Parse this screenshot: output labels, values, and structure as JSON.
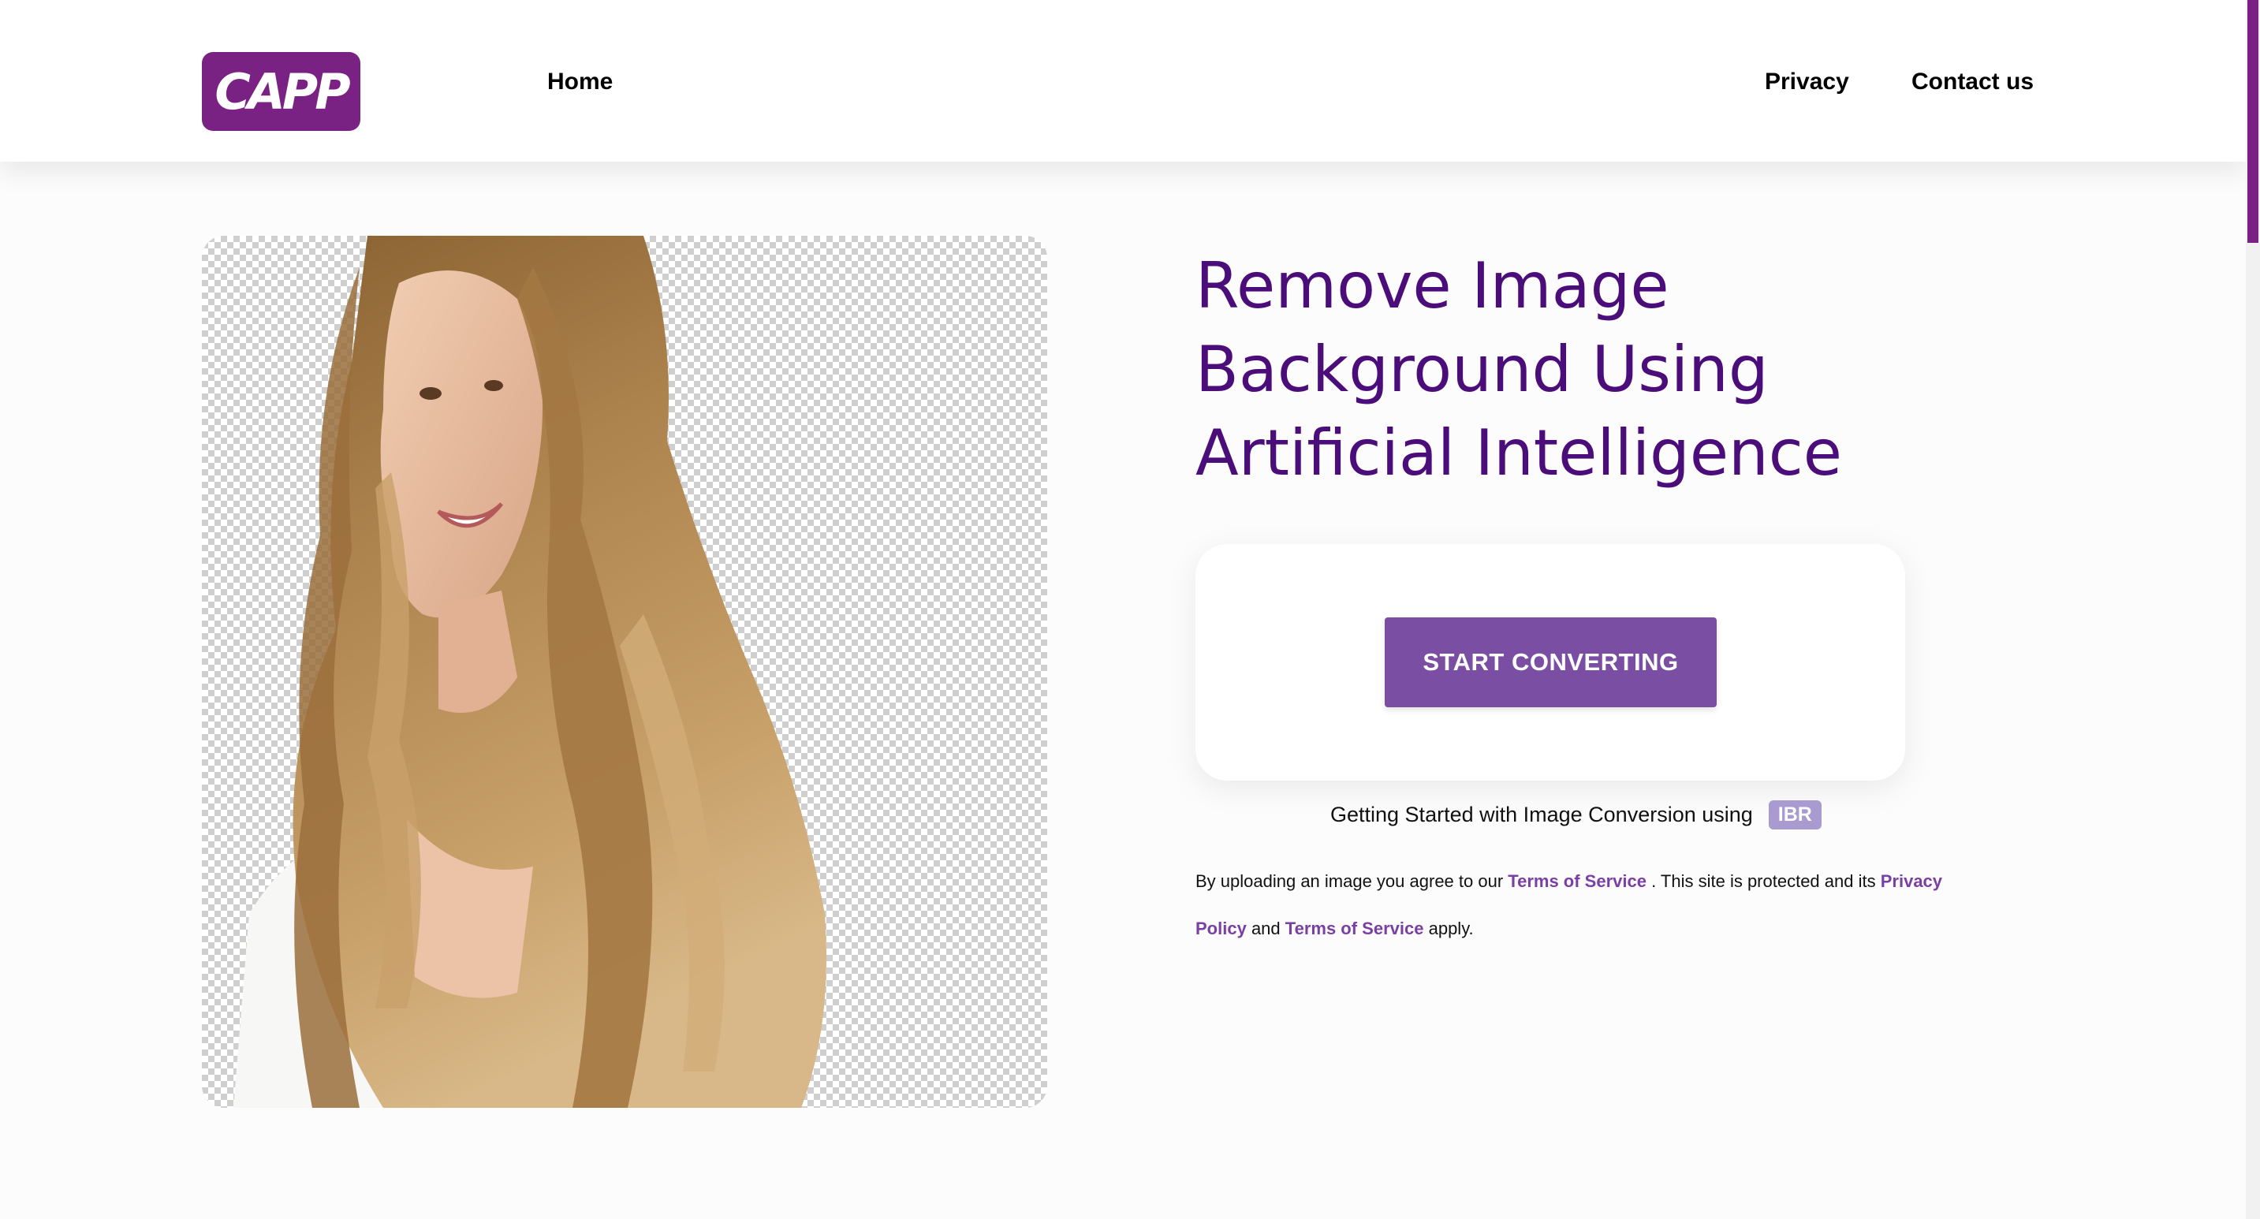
{
  "header": {
    "logo_text": "CAPP",
    "nav": {
      "home": "Home",
      "privacy": "Privacy",
      "contact": "Contact us"
    }
  },
  "hero": {
    "headline": "Remove Image Background Using Artificial Intelligence",
    "start_button": "START CONVERTING",
    "getting_started_text": "Getting Started with Image Conversion using",
    "badge": "IBR"
  },
  "terms": {
    "prefix": "By uploading an image you agree to our",
    "terms_link_1": "Terms of Service",
    "middle": ". This site is protected and its",
    "privacy_link": "Privacy Policy",
    "and": "and",
    "terms_link_2": "Terms of Service",
    "suffix": "apply."
  },
  "colors": {
    "brand": "#7a2184",
    "headline": "#4b0d7a",
    "button": "#7a4fa3",
    "badge": "#a99ad0",
    "link": "#7a3fa3"
  },
  "icons": {
    "logo": "capp-logo"
  }
}
